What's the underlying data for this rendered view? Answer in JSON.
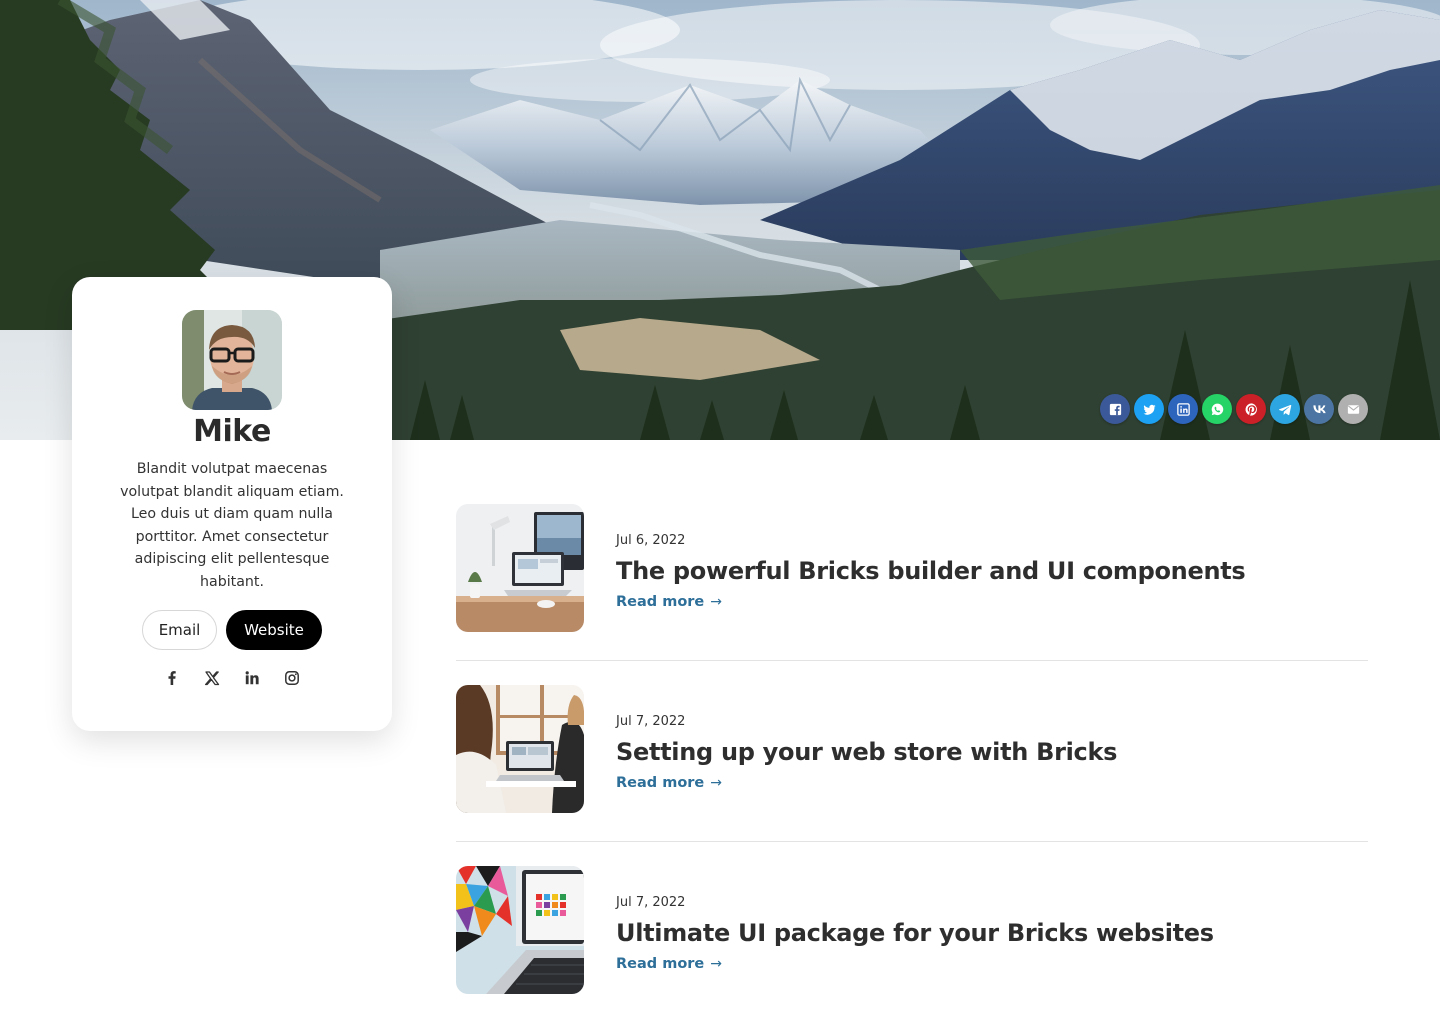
{
  "share": {
    "buttons": [
      {
        "icon": "facebook-icon",
        "color": "#3b5998"
      },
      {
        "icon": "twitter-icon",
        "color": "#1da1f2"
      },
      {
        "icon": "linkedin-icon",
        "color": "#2d64bc"
      },
      {
        "icon": "whatsapp-icon",
        "color": "#25d366"
      },
      {
        "icon": "pinterest-icon",
        "color": "#cb2027"
      },
      {
        "icon": "telegram-icon",
        "color": "#2ca5e0"
      },
      {
        "icon": "vk-icon",
        "color": "#4c75a3"
      },
      {
        "icon": "email-icon",
        "color": "#b0b0b0"
      }
    ]
  },
  "profile": {
    "name": "Mike",
    "bio": "Blandit volutpat maecenas volutpat blandit aliquam etiam. Leo duis ut diam quam nulla porttitor. Amet consectetur adipiscing elit pellentesque habitant.",
    "email_label": "Email",
    "website_label": "Website",
    "social_icons": [
      "facebook-icon",
      "x-icon",
      "linkedin-icon",
      "instagram-icon"
    ]
  },
  "posts": [
    {
      "date": "Jul 6, 2022",
      "title": "The powerful Bricks builder and UI components",
      "read_more": "Read more"
    },
    {
      "date": "Jul 7, 2022",
      "title": "Setting up your web store with Bricks",
      "read_more": "Read more"
    },
    {
      "date": "Jul 7, 2022",
      "title": "Ultimate UI package for your Bricks websites",
      "read_more": "Read more"
    }
  ],
  "colors": {
    "link": "#2e6f99",
    "title": "#2e2e2e",
    "button_dark": "#000000"
  }
}
